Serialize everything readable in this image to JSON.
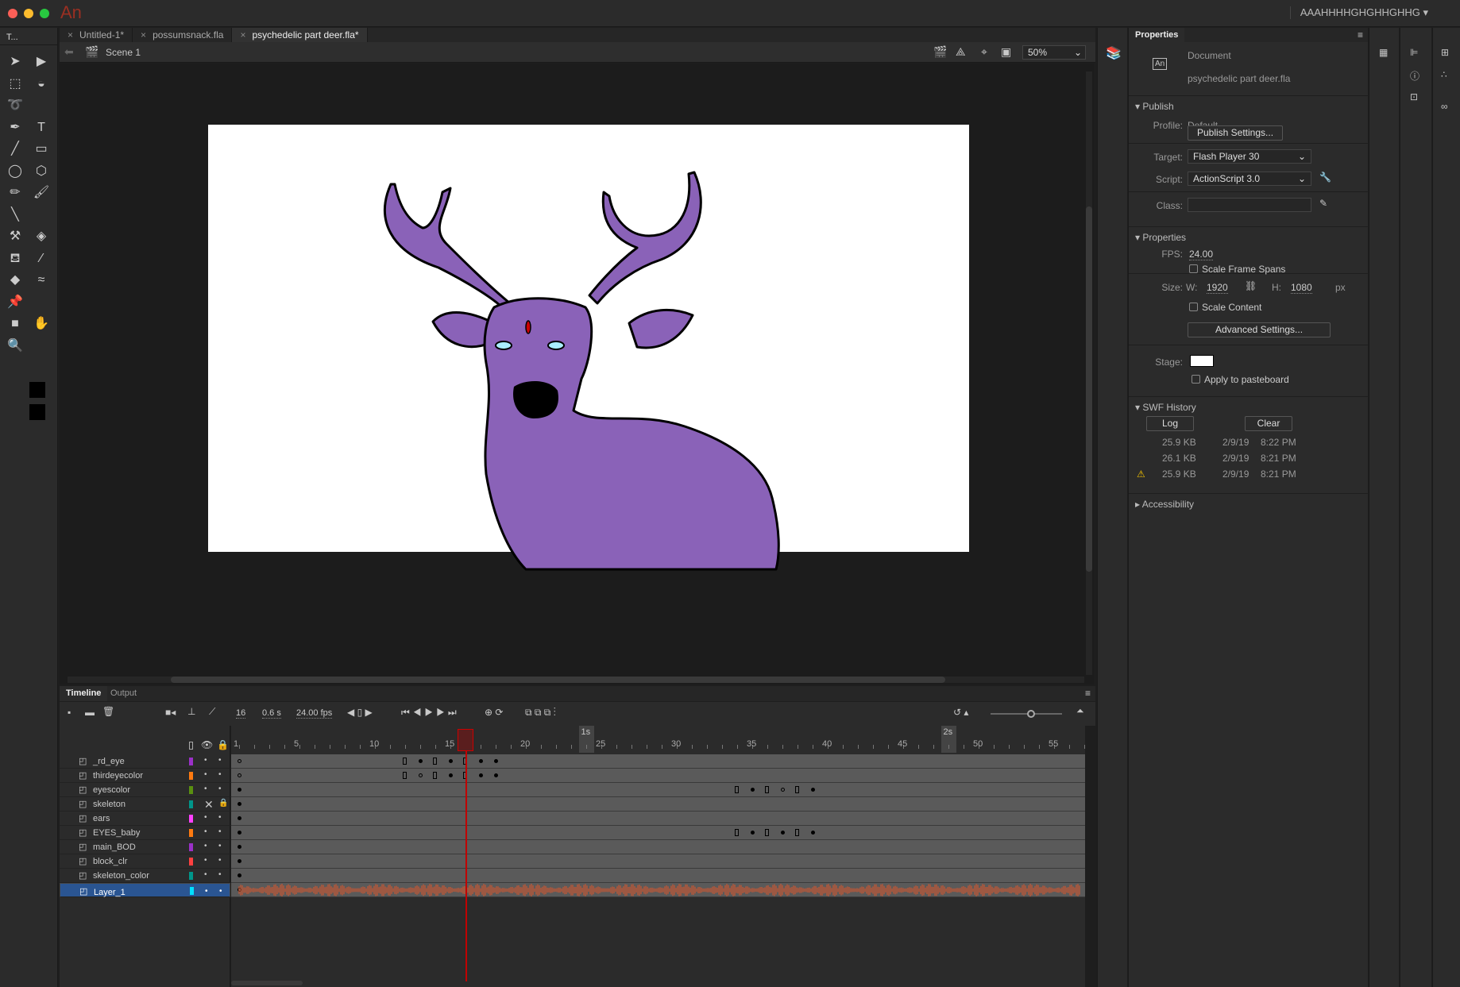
{
  "app": {
    "logo": "An",
    "user": "AAAHHHHGHGHHGHHG"
  },
  "doc_tabs": [
    {
      "label": "Untitled-1*"
    },
    {
      "label": "possumsnack.fla"
    },
    {
      "label": "psychedelic part deer.fla*",
      "active": true
    }
  ],
  "scene": {
    "label": "Scene 1",
    "zoom": "50%"
  },
  "tools_header": "T...",
  "properties": {
    "title": "Properties",
    "doc_type": "Document",
    "doc_name": "psychedelic part deer.fla",
    "doc_icon": "An",
    "publish": {
      "header": "Publish",
      "profile_label": "Profile:",
      "profile": "Default",
      "settings_btn": "Publish Settings...",
      "target_label": "Target:",
      "target": "Flash Player 30",
      "script_label": "Script:",
      "script": "ActionScript 3.0",
      "class_label": "Class:",
      "class_value": ""
    },
    "props": {
      "header": "Properties",
      "fps_label": "FPS:",
      "fps": "24.00",
      "scale_frame_spans": "Scale Frame Spans",
      "size_label": "Size:",
      "w_label": "W:",
      "w": "1920",
      "h_label": "H:",
      "h": "1080",
      "unit": "px",
      "scale_content": "Scale Content",
      "advanced_btn": "Advanced Settings...",
      "stage_label": "Stage:",
      "stage_color": "#ffffff",
      "apply_pasteboard": "Apply to pasteboard"
    },
    "swf": {
      "header": "SWF History",
      "log_btn": "Log",
      "clear_btn": "Clear",
      "entries": [
        {
          "size": "25.9 KB",
          "date": "2/9/19",
          "time": "8:22 PM",
          "warning": false
        },
        {
          "size": "26.1 KB",
          "date": "2/9/19",
          "time": "8:21 PM",
          "warning": false
        },
        {
          "size": "25.9 KB",
          "date": "2/9/19",
          "time": "8:21 PM",
          "warning": true
        }
      ]
    },
    "accessibility": "Accessibility"
  },
  "timeline": {
    "tabs": [
      "Timeline",
      "Output"
    ],
    "current_frame": "16",
    "time": "0.6 s",
    "fps": "24.00 fps",
    "ruler": [
      "1",
      "5",
      "10",
      "15",
      "20",
      "25",
      "30",
      "35",
      "40",
      "45",
      "50",
      "55"
    ],
    "seconds": [
      {
        "label": "1s",
        "frame": 24
      },
      {
        "label": "2s",
        "frame": 48
      }
    ],
    "playhead_frame": 16,
    "layers": [
      {
        "name": "_rd_eye",
        "color": "#9b30c8",
        "keys": [
          [
            1,
            "h"
          ],
          [
            12,
            "b"
          ],
          [
            13,
            "d"
          ],
          [
            14,
            "b"
          ],
          [
            15,
            "d"
          ],
          [
            16,
            "b"
          ],
          [
            17,
            "d"
          ],
          [
            18,
            "d"
          ]
        ]
      },
      {
        "name": "thirdeyecolor",
        "color": "#ff7a10",
        "keys": [
          [
            1,
            "h"
          ],
          [
            12,
            "b"
          ],
          [
            13,
            "h"
          ],
          [
            14,
            "b"
          ],
          [
            15,
            "d"
          ],
          [
            16,
            "b"
          ],
          [
            17,
            "d"
          ],
          [
            18,
            "d"
          ]
        ]
      },
      {
        "name": "eyescolor",
        "color": "#5a9010",
        "keys": [
          [
            1,
            "d"
          ],
          [
            34,
            "b"
          ],
          [
            35,
            "d"
          ],
          [
            36,
            "b"
          ],
          [
            37,
            "h"
          ],
          [
            38,
            "b"
          ],
          [
            39,
            "d"
          ]
        ]
      },
      {
        "name": "skeleton",
        "color": "#00968a",
        "hidden": true,
        "locked": true,
        "keys": [
          [
            1,
            "d"
          ]
        ]
      },
      {
        "name": "ears",
        "color": "#ff40ff",
        "keys": [
          [
            1,
            "d"
          ]
        ]
      },
      {
        "name": "EYES_baby",
        "color": "#ff7a10",
        "keys": [
          [
            1,
            "d"
          ],
          [
            34,
            "b"
          ],
          [
            35,
            "d"
          ],
          [
            36,
            "b"
          ],
          [
            37,
            "d"
          ],
          [
            38,
            "b"
          ],
          [
            39,
            "d"
          ]
        ]
      },
      {
        "name": "main_BOD",
        "color": "#9b30c8",
        "keys": [
          [
            1,
            "d"
          ]
        ]
      },
      {
        "name": "block_clr",
        "color": "#ff4040",
        "keys": [
          [
            1,
            "d"
          ]
        ]
      },
      {
        "name": "skeleton_color",
        "color": "#00968a",
        "keys": [
          [
            1,
            "d"
          ]
        ]
      },
      {
        "name": "Layer_1",
        "color": "#00e0ff",
        "selected": true,
        "audio": true,
        "keys": [
          [
            1,
            "h"
          ]
        ]
      }
    ]
  },
  "colors": {
    "deer": "#8a62b8",
    "accent": "#2a5592",
    "playhead": "#c00000",
    "audio": "#e0552a"
  }
}
